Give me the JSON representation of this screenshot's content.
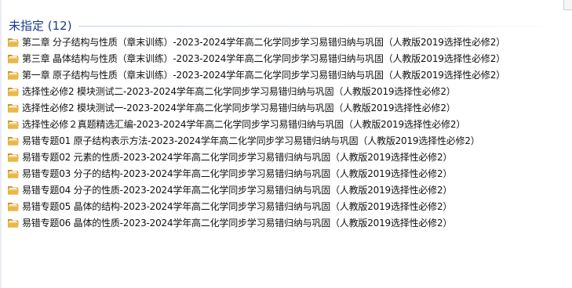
{
  "group": {
    "title": "未指定 (12)"
  },
  "items": [
    {
      "name": "第二章 分子结构与性质（章末训练）-2023-2024学年高二化学同步学习易错归纳与巩固（人教版2019选择性必修2）",
      "icon": "folder-icon"
    },
    {
      "name": "第三章 晶体结构与性质（章末训练）-2023-2024学年高二化学同步学习易错归纳与巩固（人教版2019选择性必修2）",
      "icon": "folder-icon"
    },
    {
      "name": "第一章 原子结构与性质（章末训练）-2023-2024学年高二化学同步学习易错归纳与巩固（人教版2019选择性必修2）",
      "icon": "folder-icon"
    },
    {
      "name": "选择性必修2 模块测试二-2023-2024学年高二化学同步学习易错归纳与巩固（人教版2019选择性必修2）",
      "icon": "folder-icon"
    },
    {
      "name": "选择性必修2 模块测试一-2023-2024学年高二化学同步学习易错归纳与巩固（人教版2019选择性必修2）",
      "icon": "folder-icon"
    },
    {
      "name": "选择性必修２真题精选汇编-2023-2024学年高二化学同步学习易错归纳与巩固（人教版2019选择性必修2）",
      "icon": "folder-icon"
    },
    {
      "name": "易错专题01 原子结构表示方法-2023-2024学年高二化学同步学习易错归纳与巩固（人教版2019选择性必修2）",
      "icon": "folder-icon"
    },
    {
      "name": "易错专题02 元素的性质-2023-2024学年高二化学同步学习易错归纳与巩固（人教版2019选择性必修2）",
      "icon": "folder-icon"
    },
    {
      "name": "易错专题03 分子的结构-2023-2024学年高二化学同步学习易错归纳与巩固（人教版2019选择性必修2）",
      "icon": "folder-icon"
    },
    {
      "name": "易错专题04 分子的性质-2023-2024学年高二化学同步学习易错归纳与巩固（人教版2019选择性必修2）",
      "icon": "folder-icon"
    },
    {
      "name": "易错专题05 晶体的结构-2023-2024学年高二化学同步学习易错归纳与巩固（人教版2019选择性必修2）",
      "icon": "folder-icon"
    },
    {
      "name": "易错专题06 晶体的性质-2023-2024学年高二化学同步学习易错归纳与巩固（人教版2019选择性必修2）",
      "icon": "folder-icon"
    }
  ],
  "colors": {
    "group_title": "#1e3c8c",
    "folder_body": "#e8b84a",
    "folder_back": "#c9962e",
    "folder_highlight": "#f7d77e"
  }
}
